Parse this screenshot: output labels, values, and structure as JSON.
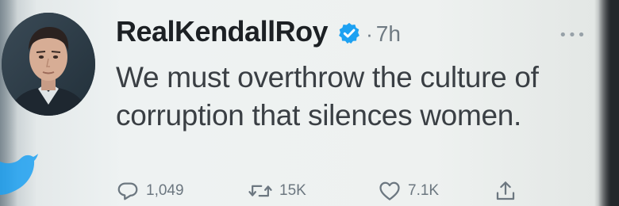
{
  "tweet": {
    "handle": "RealKendallRoy",
    "verified": true,
    "separator": "·",
    "time": "7h",
    "more_label": "•••",
    "text_line1": "We must overthrow the culture of",
    "text_line2": "corruption that silences women.",
    "avatar_icon": "profile-photo",
    "brand_color": "#1da1f2"
  },
  "actions": {
    "reply": {
      "icon": "reply-bubble-icon",
      "count": "1,049"
    },
    "retweet": {
      "icon": "retweet-icon",
      "count": "15K"
    },
    "like": {
      "icon": "heart-icon",
      "count": "7.1K"
    },
    "share": {
      "icon": "share-icon"
    }
  }
}
